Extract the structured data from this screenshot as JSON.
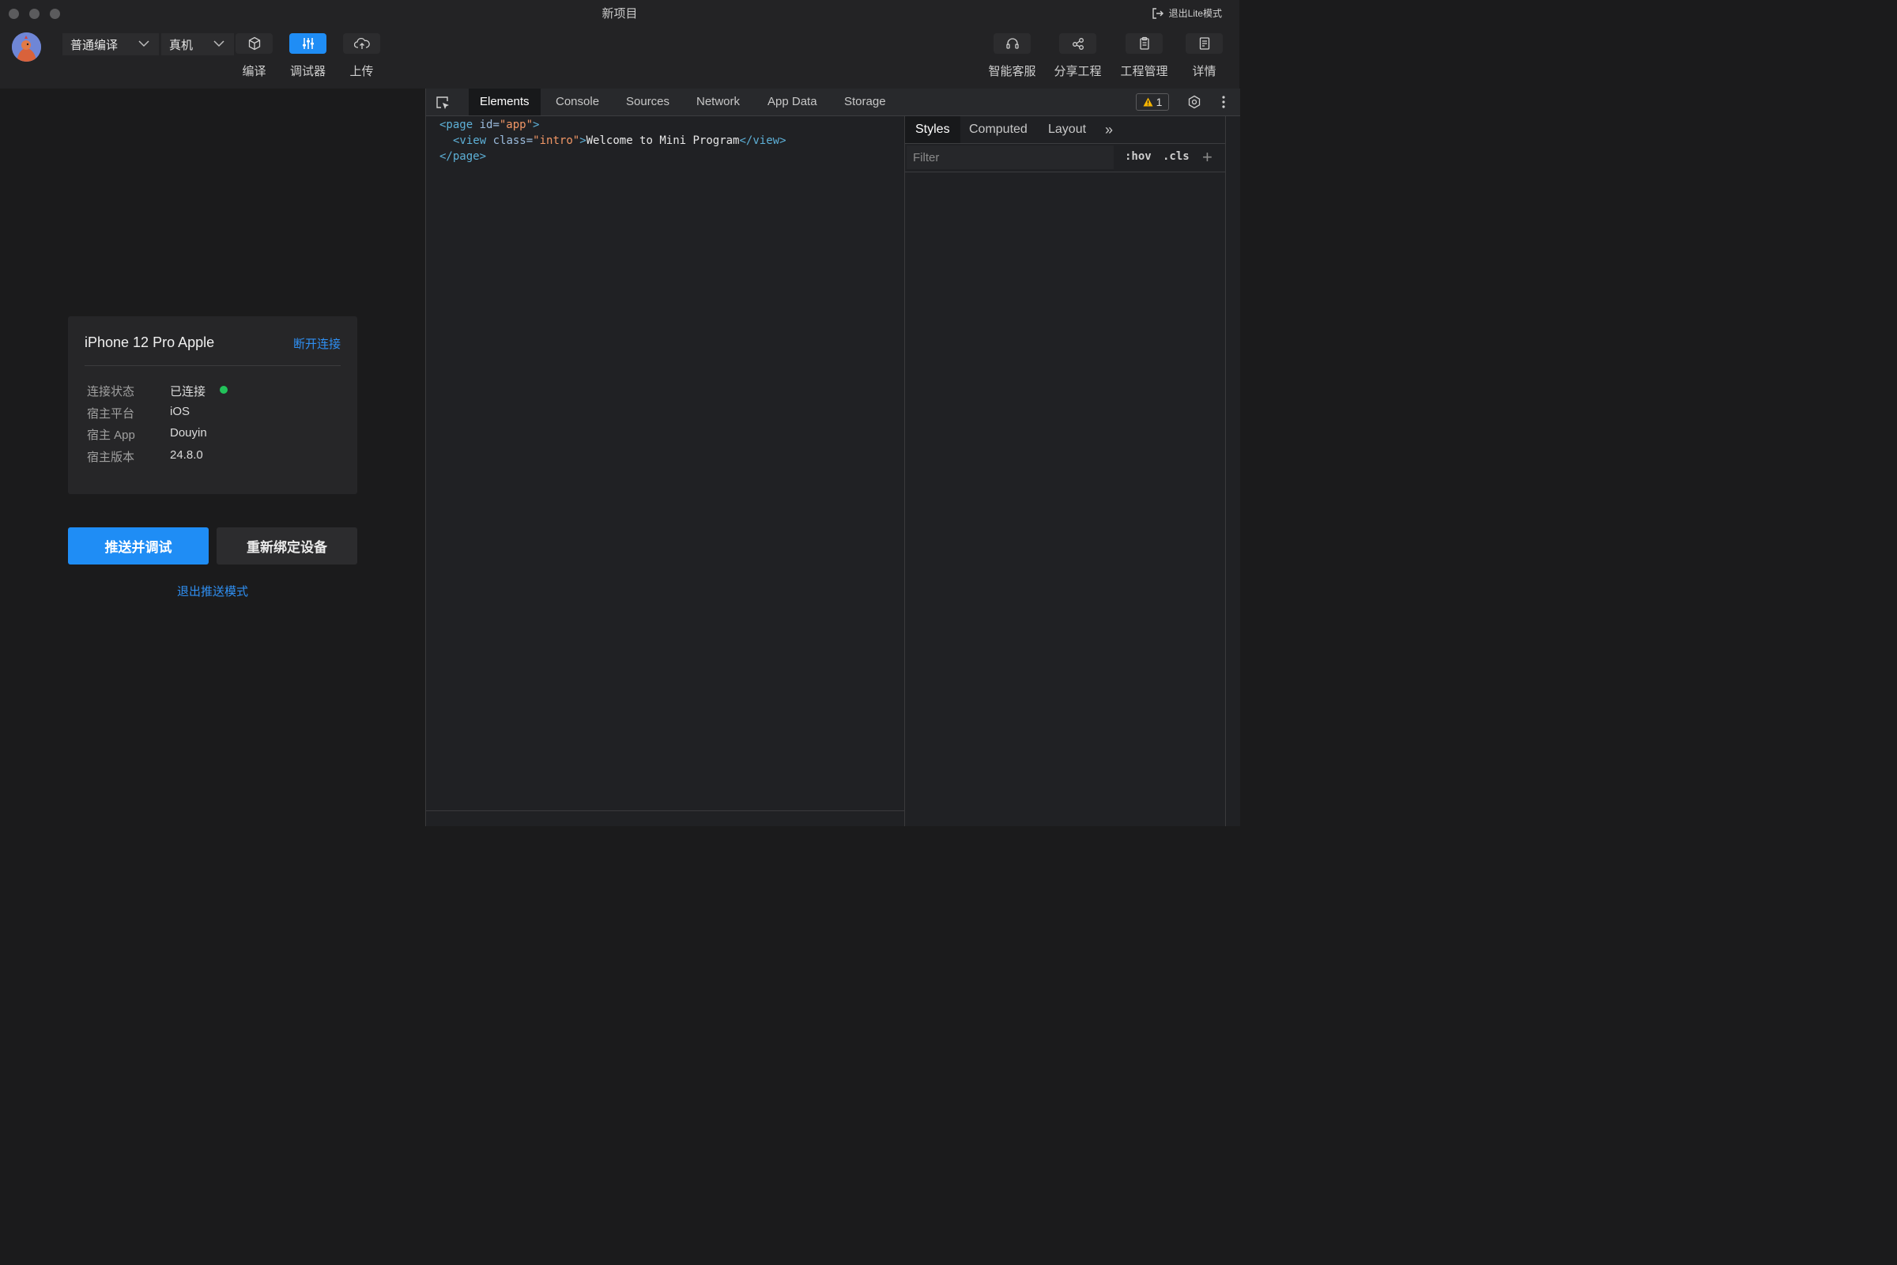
{
  "window": {
    "title": "新项目",
    "exit_lite": "退出Lite模式"
  },
  "toolbar": {
    "compile_mode": "普通编译",
    "device_mode": "真机",
    "buttons": [
      {
        "label": "编译",
        "icon": "cube-icon"
      },
      {
        "label": "调试器",
        "icon": "sliders-icon",
        "active": true
      },
      {
        "label": "上传",
        "icon": "cloud-upload-icon"
      }
    ],
    "right_buttons": [
      {
        "label": "智能客服",
        "icon": "headset-icon"
      },
      {
        "label": "分享工程",
        "icon": "share-icon"
      },
      {
        "label": "工程管理",
        "icon": "clipboard-icon"
      },
      {
        "label": "详情",
        "icon": "document-icon"
      }
    ]
  },
  "device": {
    "name": "iPhone 12 Pro Apple",
    "disconnect": "断开连接",
    "rows": [
      {
        "key": "连接状态",
        "value": "已连接"
      },
      {
        "key": "宿主平台",
        "value": "iOS"
      },
      {
        "key": "宿主 App",
        "value": "Douyin"
      },
      {
        "key": "宿主版本",
        "value": "24.8.0"
      }
    ],
    "status_color": "#22c25a"
  },
  "actions": {
    "push_debug": "推送并调试",
    "rebind": "重新绑定设备",
    "exit_push": "退出推送模式"
  },
  "devtools": {
    "tabs": [
      "Elements",
      "Console",
      "Sources",
      "Network",
      "App Data",
      "Storage"
    ],
    "active_tab": "Elements",
    "warning_count": "1",
    "dom": {
      "l1_open": "<page",
      "l1_attr": " id=",
      "l1_val": "\"app\"",
      "l1_close": ">",
      "l2_open": "<view",
      "l2_attr": " class=",
      "l2_val": "\"intro\"",
      "l2_close": ">",
      "l2_text": "Welcome to Mini Program",
      "l2_end": "</view>",
      "l3": "</page>"
    },
    "styles": {
      "tabs": [
        "Styles",
        "Computed",
        "Layout"
      ],
      "more": "»",
      "filter_placeholder": "Filter",
      "hov": ":hov",
      "cls": ".cls",
      "add": "+"
    }
  },
  "colors": {
    "accent": "#1f8df5",
    "link": "#2f8ff2"
  }
}
